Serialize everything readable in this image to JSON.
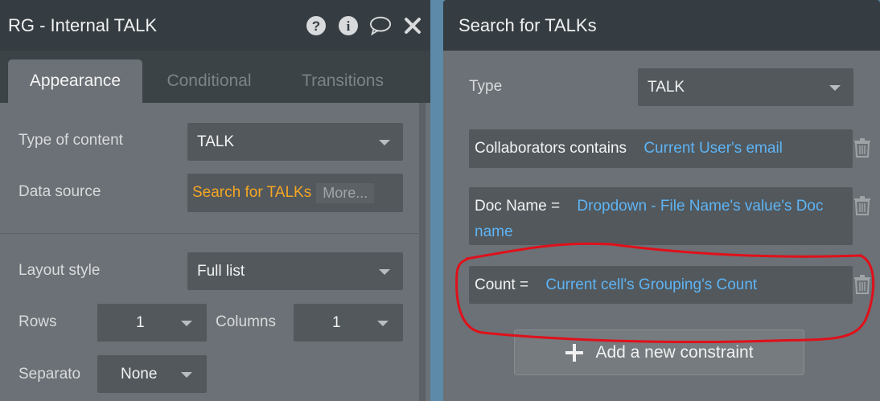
{
  "left_panel": {
    "title": "RG - Internal TALK",
    "icons": [
      "help-icon",
      "info-icon",
      "comment-icon",
      "close-icon"
    ],
    "tabs": [
      {
        "label": "Appearance",
        "active": true
      },
      {
        "label": "Conditional",
        "active": false
      },
      {
        "label": "Transitions",
        "active": false
      }
    ],
    "type_of_content": {
      "label": "Type of content",
      "value": "TALK"
    },
    "data_source": {
      "label": "Data source",
      "value": "Search for TALKs",
      "more": "More..."
    },
    "layout_style": {
      "label": "Layout style",
      "value": "Full list"
    },
    "rows": {
      "label": "Rows",
      "value": "1"
    },
    "columns": {
      "label": "Columns",
      "value": "1"
    },
    "separator": {
      "label": "Separato",
      "value": "None"
    }
  },
  "right_panel": {
    "title": "Search for TALKs",
    "type": {
      "label": "Type",
      "value": "TALK"
    },
    "constraints": [
      {
        "key": "Collaborators contains",
        "value": "Current User's email"
      },
      {
        "key": "Doc Name =",
        "value": "Dropdown - File Name's value's Doc",
        "value_line2": "name"
      },
      {
        "key": "Count =",
        "value": "Current cell's Grouping's Count"
      }
    ],
    "add_constraint_label": "Add a new constraint"
  },
  "colors": {
    "titlebar": "#353d42",
    "panel": "#6b7176",
    "field": "#52585c",
    "link_orange": "#f5a623",
    "link_blue": "#5eb4f5",
    "annotation_red": "#e0101a"
  }
}
